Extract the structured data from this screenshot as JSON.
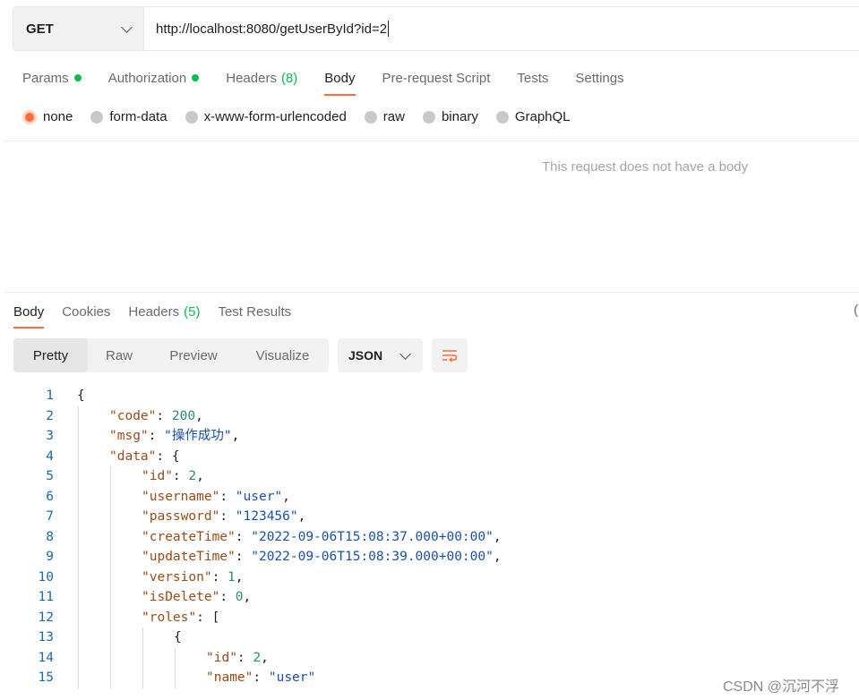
{
  "request": {
    "method": "GET",
    "url": "http://localhost:8080/getUserById?id=2"
  },
  "request_tabs": [
    {
      "label": "Params",
      "dot": true
    },
    {
      "label": "Authorization",
      "dot": true
    },
    {
      "label": "Headers",
      "count": "(8)"
    },
    {
      "label": "Body",
      "active": true
    },
    {
      "label": "Pre-request Script"
    },
    {
      "label": "Tests"
    },
    {
      "label": "Settings"
    }
  ],
  "body_types": [
    "none",
    "form-data",
    "x-www-form-urlencoded",
    "raw",
    "binary",
    "GraphQL"
  ],
  "body_selected": "none",
  "no_body_message": "This request does not have a body",
  "response_tabs": [
    {
      "label": "Body",
      "active": true
    },
    {
      "label": "Cookies"
    },
    {
      "label": "Headers",
      "count": "(5)"
    },
    {
      "label": "Test Results"
    }
  ],
  "view_modes": [
    "Pretty",
    "Raw",
    "Preview",
    "Visualize"
  ],
  "view_selected": "Pretty",
  "format": "JSON",
  "edge_glyph": "(",
  "code_lines": [
    {
      "n": "1",
      "indent": 0,
      "parts": [
        [
          "pun",
          "{"
        ]
      ]
    },
    {
      "n": "2",
      "indent": 1,
      "parts": [
        [
          "key",
          "\"code\""
        ],
        [
          "pun",
          ": "
        ],
        [
          "num",
          "200"
        ],
        [
          "pun",
          ","
        ]
      ]
    },
    {
      "n": "3",
      "indent": 1,
      "parts": [
        [
          "key",
          "\"msg\""
        ],
        [
          "pun",
          ": "
        ],
        [
          "str",
          "\"操作成功\""
        ],
        [
          "pun",
          ","
        ]
      ]
    },
    {
      "n": "4",
      "indent": 1,
      "parts": [
        [
          "key",
          "\"data\""
        ],
        [
          "pun",
          ": {"
        ]
      ]
    },
    {
      "n": "5",
      "indent": 2,
      "parts": [
        [
          "key",
          "\"id\""
        ],
        [
          "pun",
          ": "
        ],
        [
          "num",
          "2"
        ],
        [
          "pun",
          ","
        ]
      ]
    },
    {
      "n": "6",
      "indent": 2,
      "parts": [
        [
          "key",
          "\"username\""
        ],
        [
          "pun",
          ": "
        ],
        [
          "str",
          "\"user\""
        ],
        [
          "pun",
          ","
        ]
      ]
    },
    {
      "n": "7",
      "indent": 2,
      "parts": [
        [
          "key",
          "\"password\""
        ],
        [
          "pun",
          ": "
        ],
        [
          "str",
          "\"123456\""
        ],
        [
          "pun",
          ","
        ]
      ]
    },
    {
      "n": "8",
      "indent": 2,
      "parts": [
        [
          "key",
          "\"createTime\""
        ],
        [
          "pun",
          ": "
        ],
        [
          "str",
          "\"2022-09-06T15:08:37.000+00:00\""
        ],
        [
          "pun",
          ","
        ]
      ]
    },
    {
      "n": "9",
      "indent": 2,
      "parts": [
        [
          "key",
          "\"updateTime\""
        ],
        [
          "pun",
          ": "
        ],
        [
          "str",
          "\"2022-09-06T15:08:39.000+00:00\""
        ],
        [
          "pun",
          ","
        ]
      ]
    },
    {
      "n": "10",
      "indent": 2,
      "parts": [
        [
          "key",
          "\"version\""
        ],
        [
          "pun",
          ": "
        ],
        [
          "num",
          "1"
        ],
        [
          "pun",
          ","
        ]
      ]
    },
    {
      "n": "11",
      "indent": 2,
      "parts": [
        [
          "key",
          "\"isDelete\""
        ],
        [
          "pun",
          ": "
        ],
        [
          "num",
          "0"
        ],
        [
          "pun",
          ","
        ]
      ]
    },
    {
      "n": "12",
      "indent": 2,
      "parts": [
        [
          "key",
          "\"roles\""
        ],
        [
          "pun",
          ": ["
        ]
      ]
    },
    {
      "n": "13",
      "indent": 3,
      "parts": [
        [
          "pun",
          "{"
        ]
      ]
    },
    {
      "n": "14",
      "indent": 4,
      "parts": [
        [
          "key",
          "\"id\""
        ],
        [
          "pun",
          ": "
        ],
        [
          "num",
          "2"
        ],
        [
          "pun",
          ","
        ]
      ]
    },
    {
      "n": "15",
      "indent": 4,
      "parts": [
        [
          "key",
          "\"name\""
        ],
        [
          "pun",
          ": "
        ],
        [
          "str",
          "\"user\""
        ]
      ]
    }
  ],
  "watermark": "CSDN @沉河不浮",
  "colors": {
    "accent": "#ff6c37",
    "status_dot": "#0cbb52"
  }
}
